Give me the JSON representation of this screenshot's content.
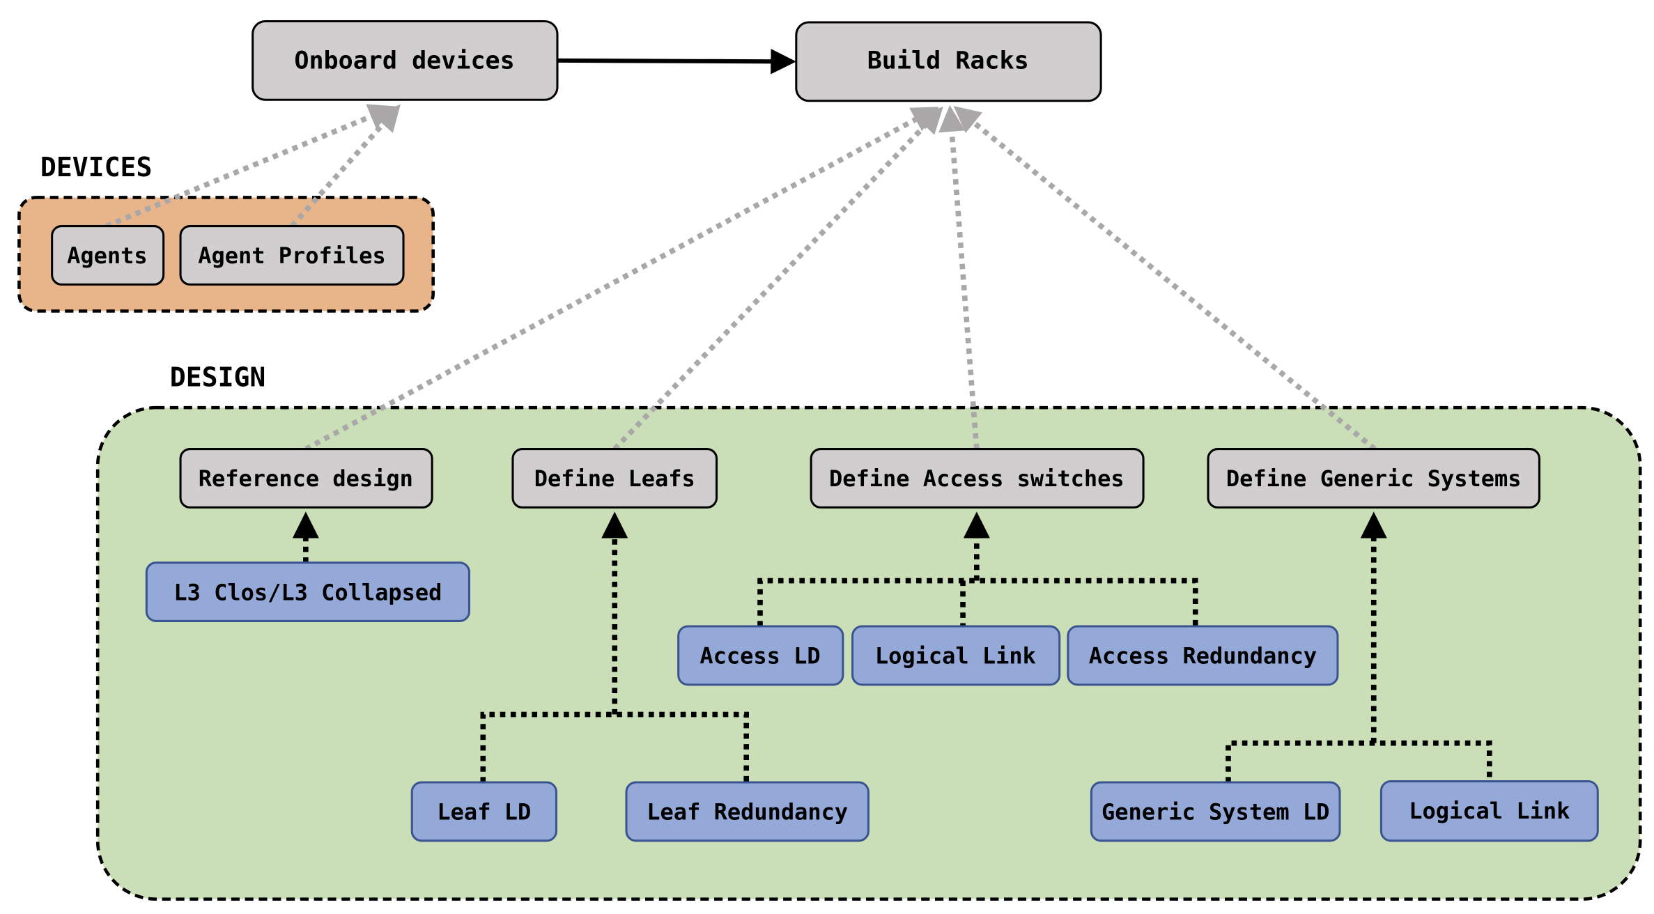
{
  "top": {
    "onboard": "Onboard devices",
    "build_racks": "Build Racks"
  },
  "devices": {
    "title": "DEVICES",
    "items": [
      "Agents",
      "Agent Profiles"
    ],
    "fill": "#e8b48a"
  },
  "design": {
    "title": "DESIGN",
    "fill": "#cadfb8",
    "categories": [
      "Reference design",
      "Define Leafs",
      "Define Access switches",
      "Define Generic Systems"
    ],
    "reference_children": [
      "L3 Clos/L3 Collapsed"
    ],
    "leaf_children": [
      "Leaf LD",
      "Leaf Redundancy"
    ],
    "access_children": [
      "Access LD",
      "Logical Link",
      "Access Redundancy"
    ],
    "generic_children": [
      "Generic System LD",
      "Logical Link"
    ]
  },
  "colors": {
    "gray_box": "#d0cece",
    "blue_box": "#95a9d8",
    "blue_border": "#3a5490",
    "gray_link": "#a9a7a7"
  }
}
